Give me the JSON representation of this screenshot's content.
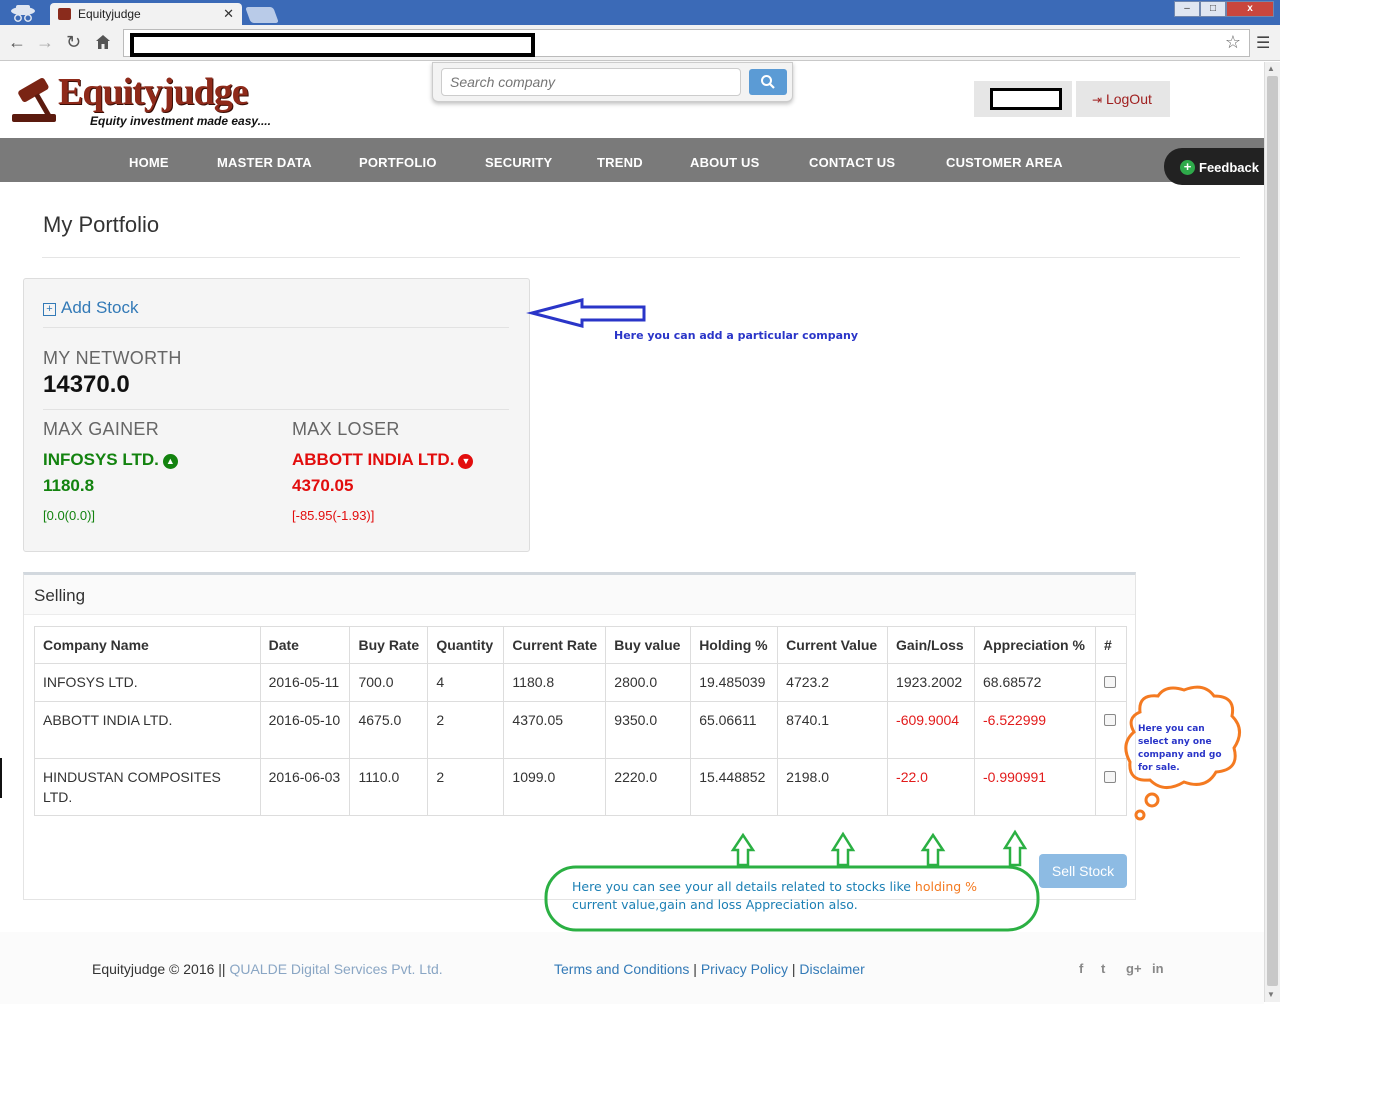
{
  "browser": {
    "tab_title": "Equityjudge",
    "win_min": "–",
    "win_max": "□",
    "win_close": "x"
  },
  "header": {
    "logo_text": "Equityjudge",
    "tagline": "Equity investment made easy....",
    "search_placeholder": "Search company",
    "logout_label": "LogOut"
  },
  "nav": {
    "items": [
      "HOME",
      "MASTER DATA",
      "PORTFOLIO",
      "SECURITY",
      "TREND",
      "ABOUT US",
      "CONTACT US",
      "CUSTOMER AREA"
    ],
    "feedback_label": "Feedback"
  },
  "page": {
    "title": "My Portfolio"
  },
  "portfolio": {
    "add_stock_label": "Add Stock",
    "networth_label": "MY NETWORTH",
    "networth_value": "14370.0",
    "max_gainer_label": "MAX GAINER",
    "max_gainer_name": "INFOSYS LTD.",
    "max_gainer_rate": "1180.8",
    "max_gainer_change": "[0.0(0.0)]",
    "max_loser_label": "MAX LOSER",
    "max_loser_name": "ABBOTT INDIA LTD.",
    "max_loser_rate": "4370.05",
    "max_loser_change": "[-85.95(-1.93)]"
  },
  "selling": {
    "title": "Selling",
    "columns": [
      "Company Name",
      "Date",
      "Buy Rate",
      "Quantity",
      "Current Rate",
      "Buy value",
      "Holding %",
      "Current Value",
      "Gain/Loss",
      "Appreciation %",
      "#"
    ],
    "rows": [
      {
        "company": "INFOSYS LTD.",
        "date": "2016-05-11",
        "buy_rate": "700.0",
        "quantity": "4",
        "current_rate": "1180.8",
        "buy_value": "2800.0",
        "holding": "19.485039",
        "current_value": "4723.2",
        "gain_loss": "1923.2002",
        "appreciation": "68.68572",
        "negative": false
      },
      {
        "company": "ABBOTT INDIA LTD.",
        "date": "2016-05-10",
        "buy_rate": "4675.0",
        "quantity": "2",
        "current_rate": "4370.05",
        "buy_value": "9350.0",
        "holding": "65.06611",
        "current_value": "8740.1",
        "gain_loss": "-609.9004",
        "appreciation": "-6.522999",
        "negative": true
      },
      {
        "company": "HINDUSTAN COMPOSITES LTD.",
        "date": "2016-06-03",
        "buy_rate": "1110.0",
        "quantity": "2",
        "current_rate": "1099.0",
        "buy_value": "2220.0",
        "holding": "15.448852",
        "current_value": "2198.0",
        "gain_loss": "-22.0",
        "appreciation": "-0.990991",
        "negative": true
      }
    ],
    "sell_button_label": "Sell Stock"
  },
  "footer": {
    "copyright": "Equityjudge © 2016 ||",
    "company": "QUALDE Digital Services Pvt. Ltd.",
    "terms": "Terms and Conditions",
    "privacy": "Privacy Policy",
    "disclaimer": "Disclaimer",
    "separator": "|",
    "social": [
      "f",
      "t",
      "g+",
      "in"
    ]
  },
  "annotations": {
    "add_note": "Here you can add a particular company",
    "detail_note_before": "Here you can see your all details related to stocks like ",
    "detail_note_highlight": "holding %",
    "detail_note_after": " current value,gain and loss Appreciation also.",
    "sale_note": "Here you can select any one company and go for sale."
  },
  "colors": {
    "gain": "#13830f",
    "loss": "#e20d0d",
    "link": "#337ab7",
    "nav_bg": "#7a7a7a",
    "note_blue": "#2a35c8",
    "note_green": "#2bb043",
    "note_orange": "#f47a21"
  }
}
